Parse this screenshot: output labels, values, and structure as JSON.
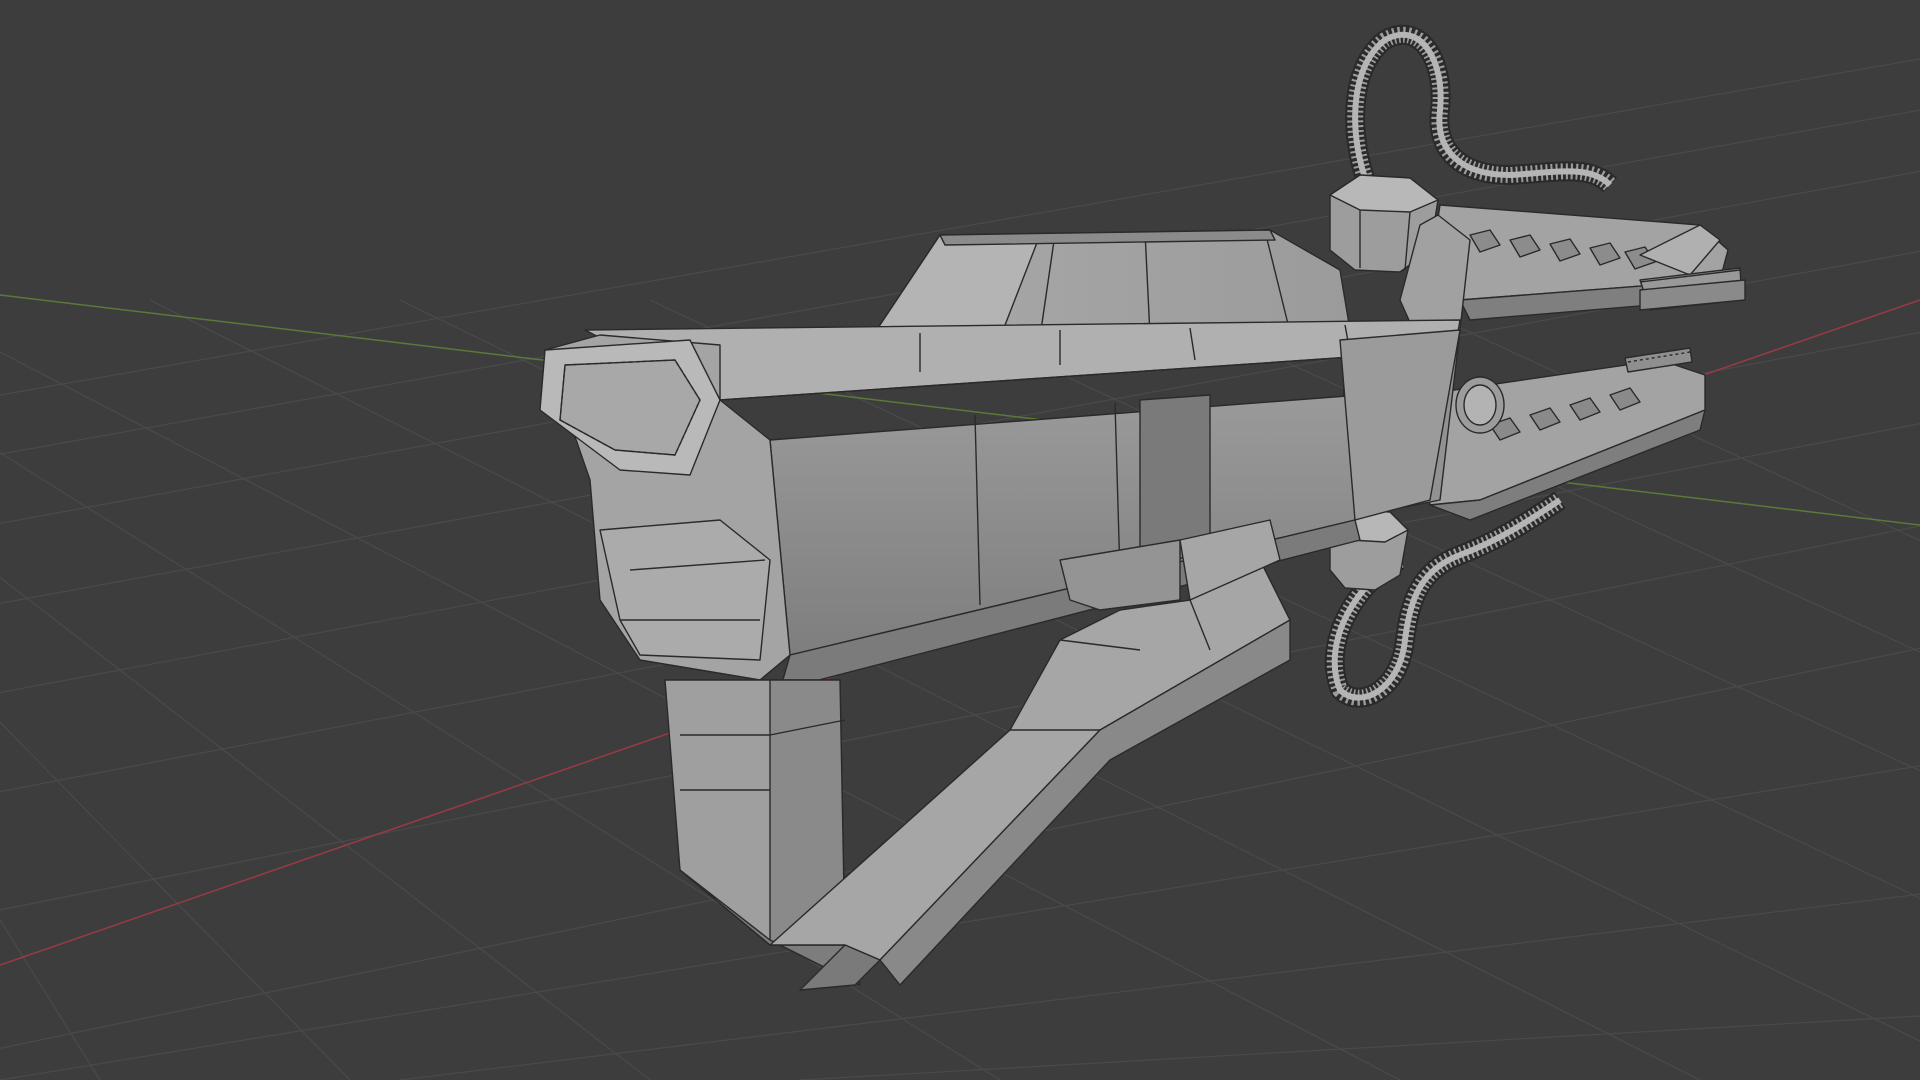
{
  "viewport": {
    "mode": "3d-viewport",
    "shading": "solid-with-wireframe",
    "colors": {
      "background": "#3d3d3d",
      "grid": "#4a4a4a",
      "x_axis": "#9a3a43",
      "y_axis": "#5a7a35",
      "mesh_light": "#a8a8a8",
      "mesh_mid": "#8c8c8c",
      "mesh_dark": "#6e6e6e",
      "wire": "#2a2a2a"
    },
    "object": {
      "name_icon": "mesh-object-icon",
      "parts": [
        "stock",
        "receiver",
        "upper-rail",
        "lower-barrel",
        "upper-barrel",
        "coiled-cable-upper",
        "coiled-cable-lower",
        "knobs"
      ]
    }
  }
}
